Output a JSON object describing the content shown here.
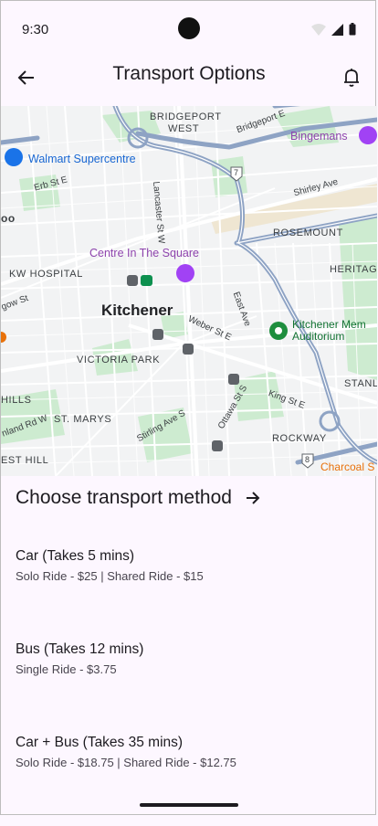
{
  "status_bar": {
    "time": "9:30"
  },
  "app_bar": {
    "title": "Transport Options",
    "back_icon": "arrow-back-icon",
    "action_icon": "bell-icon"
  },
  "map": {
    "labels": {
      "bridgeport_west": "BRIDGEPORT",
      "bridgeport_west_2": "WEST",
      "bridgeport_east": "Bridgeport E",
      "bingemans": "Bingemans",
      "walmart": "Walmart Supercentre",
      "erb": "Erb St E",
      "lancaster": "Lancaster St W",
      "shirley": "Shirley Ave",
      "hwy7": "7",
      "hwy8": "8",
      "oo": "oo",
      "centre": "Centre In The Square",
      "rosemount": "ROSEMOUNT",
      "heritage": "HERITAG",
      "kw_hospital": "KW HOSPITAL",
      "gow": "gow St",
      "kitchener": "Kitchener",
      "east_ave": "East Ave",
      "weber": "Weber St E",
      "memorial_1": "Kitchener Mem",
      "memorial_2": "Auditorium",
      "victoria_park": "VICTORIA PARK",
      "stanl": "STANL",
      "ottawa": "Ottawa St S",
      "king": "King St E",
      "hills": "HILLS",
      "st_marys": "ST. MARYS",
      "stirling": "Stirling Ave S",
      "homer": "nland Rd W",
      "rockway": "ROCKWAY",
      "est_hill": "EST HILL",
      "charcoal": "Charcoal S"
    }
  },
  "section": {
    "title": "Choose transport method",
    "arrow_icon": "arrow-forward-icon"
  },
  "options": [
    {
      "title": "Car (Takes 5 mins)",
      "subtitle": "Solo Ride - $25 | Shared Ride - $15"
    },
    {
      "title": "Bus (Takes 12 mins)",
      "subtitle": "Single Ride - $3.75"
    },
    {
      "title": "Car + Bus (Takes 35 mins)",
      "subtitle": "Solo Ride - $18.75 | Shared Ride - $12.75"
    }
  ]
}
